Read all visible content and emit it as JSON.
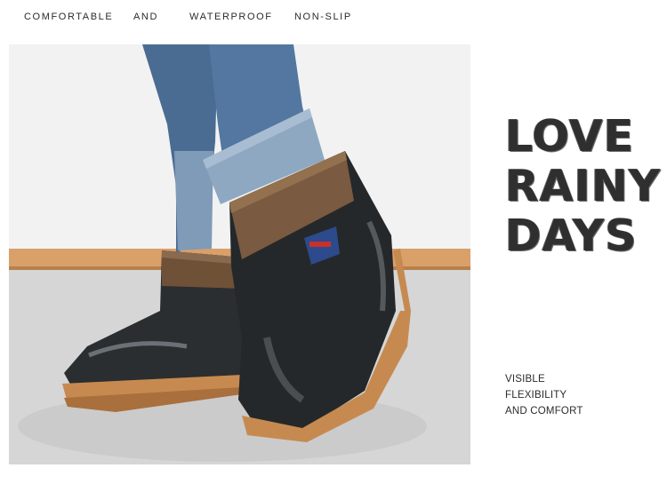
{
  "tagline": {
    "words": [
      "COMFORTABLE",
      "AND",
      "WATERPROOF",
      "NON-SLIP"
    ]
  },
  "photo": {
    "subject": "black rain boots with brown fleece cuff",
    "colors": {
      "boot": "#2a2d2f",
      "sole": "#c98a4e",
      "cuff": "#7a5a40",
      "jeans": "#4d6f93",
      "floor": "#d9d9d9",
      "wall": "#f1f1f1",
      "baseboard": "#d79a62"
    }
  },
  "headline": {
    "lines": [
      "LOVE",
      "RAINY",
      "DAYS"
    ]
  },
  "features": {
    "lines": [
      "VISIBLE",
      "FLEXIBILITY",
      "AND COMFORT"
    ]
  }
}
